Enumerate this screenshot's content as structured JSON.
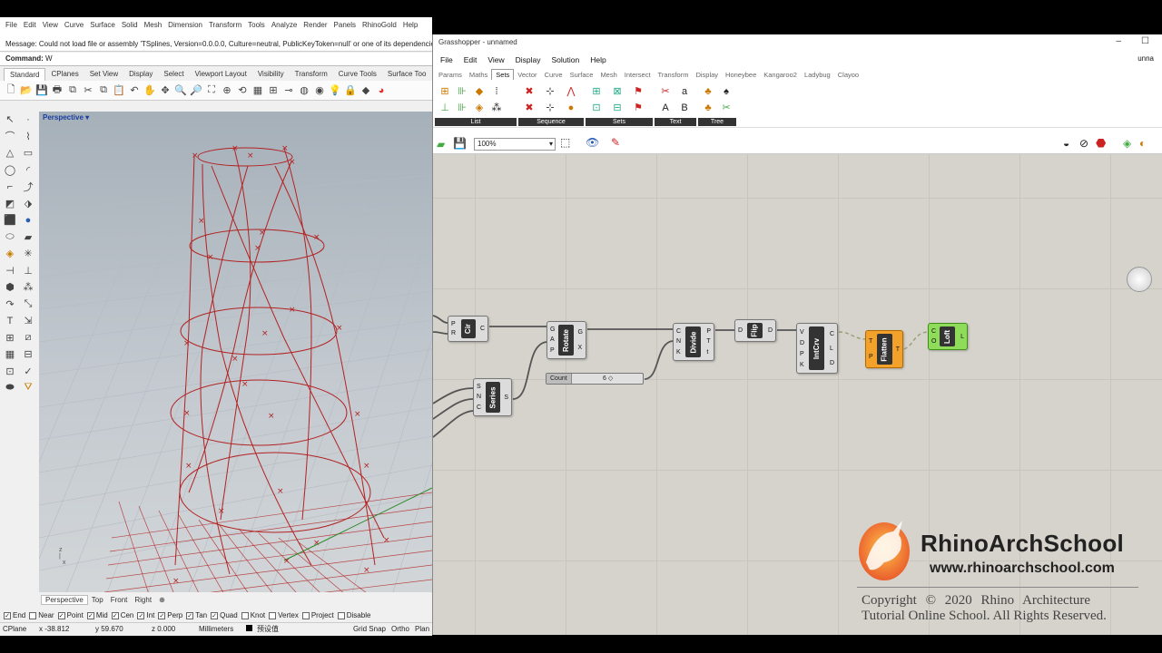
{
  "rhino": {
    "menu": [
      "File",
      "Edit",
      "View",
      "Curve",
      "Surface",
      "Solid",
      "Mesh",
      "Dimension",
      "Transform",
      "Tools",
      "Analyze",
      "Render",
      "Panels",
      "RhinoGold",
      "Help"
    ],
    "message": "Message: Could not load file or assembly 'TSplines, Version=0.0.0.0, Culture=neutral, PublicKeyToken=null' or one of its dependencie",
    "command_label": "Command:",
    "command_value": "W",
    "toolbar_tabs": [
      "Standard",
      "CPlanes",
      "Set View",
      "Display",
      "Select",
      "Viewport Layout",
      "Visibility",
      "Transform",
      "Curve Tools",
      "Surface Too"
    ],
    "viewport_title": "Perspective",
    "viewport_tabs": [
      "Perspective",
      "Top",
      "Front",
      "Right"
    ],
    "osnaps": [
      {
        "label": "End",
        "checked": true
      },
      {
        "label": "Near",
        "checked": false
      },
      {
        "label": "Point",
        "checked": true
      },
      {
        "label": "Mid",
        "checked": true
      },
      {
        "label": "Cen",
        "checked": true
      },
      {
        "label": "Int",
        "checked": true
      },
      {
        "label": "Perp",
        "checked": true
      },
      {
        "label": "Tan",
        "checked": true
      },
      {
        "label": "Quad",
        "checked": true
      },
      {
        "label": "Knot",
        "checked": false
      },
      {
        "label": "Vertex",
        "checked": false
      },
      {
        "label": "Project",
        "checked": false
      },
      {
        "label": "Disable",
        "checked": false
      }
    ],
    "status": {
      "cplane": "CPlane",
      "x": "x -38.812",
      "y": "y 59.670",
      "z": "z 0.000",
      "units": "Millimeters",
      "layer": "预设值",
      "grid_snap": "Grid Snap",
      "ortho": "Ortho",
      "planar": "Plan"
    }
  },
  "gh": {
    "title": "Grasshopper - unnamed",
    "document": "unna",
    "menu": [
      "File",
      "Edit",
      "View",
      "Display",
      "Solution",
      "Help"
    ],
    "tabs": [
      "Params",
      "Maths",
      "Sets",
      "Vector",
      "Curve",
      "Surface",
      "Mesh",
      "Intersect",
      "Transform",
      "Display",
      "Honeybee",
      "Kangaroo2",
      "Ladybug",
      "Clayoo"
    ],
    "active_tab": "Sets",
    "ribbon_groups": [
      "List",
      "Sequence",
      "Sets",
      "Text",
      "Tree"
    ],
    "zoom": "100%",
    "components": {
      "circle": {
        "name": "Cir",
        "inputs": [
          "P",
          "R"
        ],
        "outputs": [
          "C"
        ]
      },
      "rotate": {
        "name": "Rotate",
        "inputs": [
          "G",
          "A",
          "P"
        ],
        "outputs": [
          "G",
          "X"
        ]
      },
      "series": {
        "name": "Series",
        "inputs": [
          "S",
          "N",
          "C"
        ],
        "outputs": [
          "S"
        ]
      },
      "divide": {
        "name": "Divide",
        "inputs": [
          "C",
          "N",
          "K"
        ],
        "outputs": [
          "P",
          "T",
          "t"
        ]
      },
      "flip": {
        "name": "Flip",
        "inputs": [
          "D"
        ],
        "outputs": [
          "D"
        ]
      },
      "intcrv": {
        "name": "IntCrv",
        "inputs": [
          "V",
          "D",
          "P",
          "K"
        ],
        "outputs": [
          "C",
          "L",
          "D"
        ]
      },
      "flatten": {
        "name": "Flatten",
        "inputs": [
          "T",
          "P"
        ],
        "outputs": [
          "T"
        ]
      },
      "loft": {
        "name": "Loft",
        "inputs": [
          "C",
          "O"
        ],
        "outputs": [
          "L"
        ]
      }
    },
    "slider": {
      "label": "Count",
      "value": "6 ◇"
    }
  },
  "watermark": {
    "title": "RhinoArchSchool",
    "url": "www.rhinoarchschool.com",
    "copyright_line1": "Copyright © 2020 Rhino Architecture",
    "copyright_line2": "Tutorial Online School. All Rights Reserved."
  },
  "colors": {
    "curve": "#b22222",
    "flatten": "#f2a22b",
    "loft": "#8fdc5b",
    "canvas": "#d5d3cb"
  }
}
